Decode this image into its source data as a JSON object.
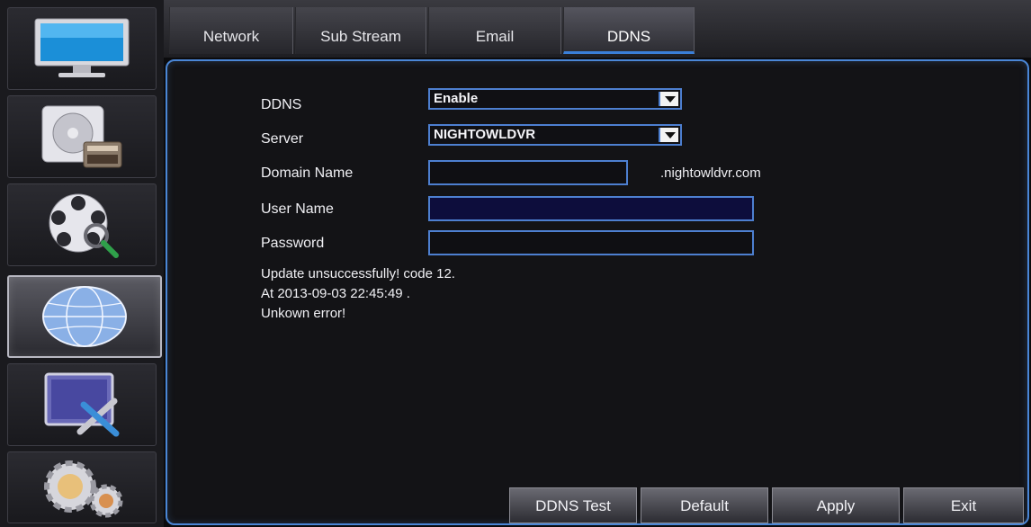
{
  "tabs": [
    {
      "label": "Network",
      "active": false
    },
    {
      "label": "Sub Stream",
      "active": false
    },
    {
      "label": "Email",
      "active": false
    },
    {
      "label": "DDNS",
      "active": true
    }
  ],
  "sidebar": {
    "items": [
      {
        "icon": "monitor-icon"
      },
      {
        "icon": "disk-icon"
      },
      {
        "icon": "film-reel-icon"
      },
      {
        "icon": "globe-icon",
        "active": true
      },
      {
        "icon": "maintenance-icon"
      },
      {
        "icon": "gears-icon"
      }
    ]
  },
  "form": {
    "ddns": {
      "label": "DDNS",
      "value": "Enable"
    },
    "server": {
      "label": "Server",
      "value": "NIGHTOWLDVR"
    },
    "domain": {
      "label": "Domain Name",
      "value": "",
      "suffix": ".nightowldvr.com"
    },
    "username": {
      "label": "User Name",
      "value": ""
    },
    "password": {
      "label": "Password",
      "value": ""
    }
  },
  "status": {
    "line1": "Update unsuccessfully! code 12.",
    "line2": "At 2013-09-03 22:45:49 .",
    "line3": "Unkown error!"
  },
  "buttons": {
    "ddns_test": "DDNS Test",
    "default": "Default",
    "apply": "Apply",
    "exit": "Exit"
  },
  "colors": {
    "accent": "#4a86d6",
    "filled_field": "#0d0d3c"
  }
}
